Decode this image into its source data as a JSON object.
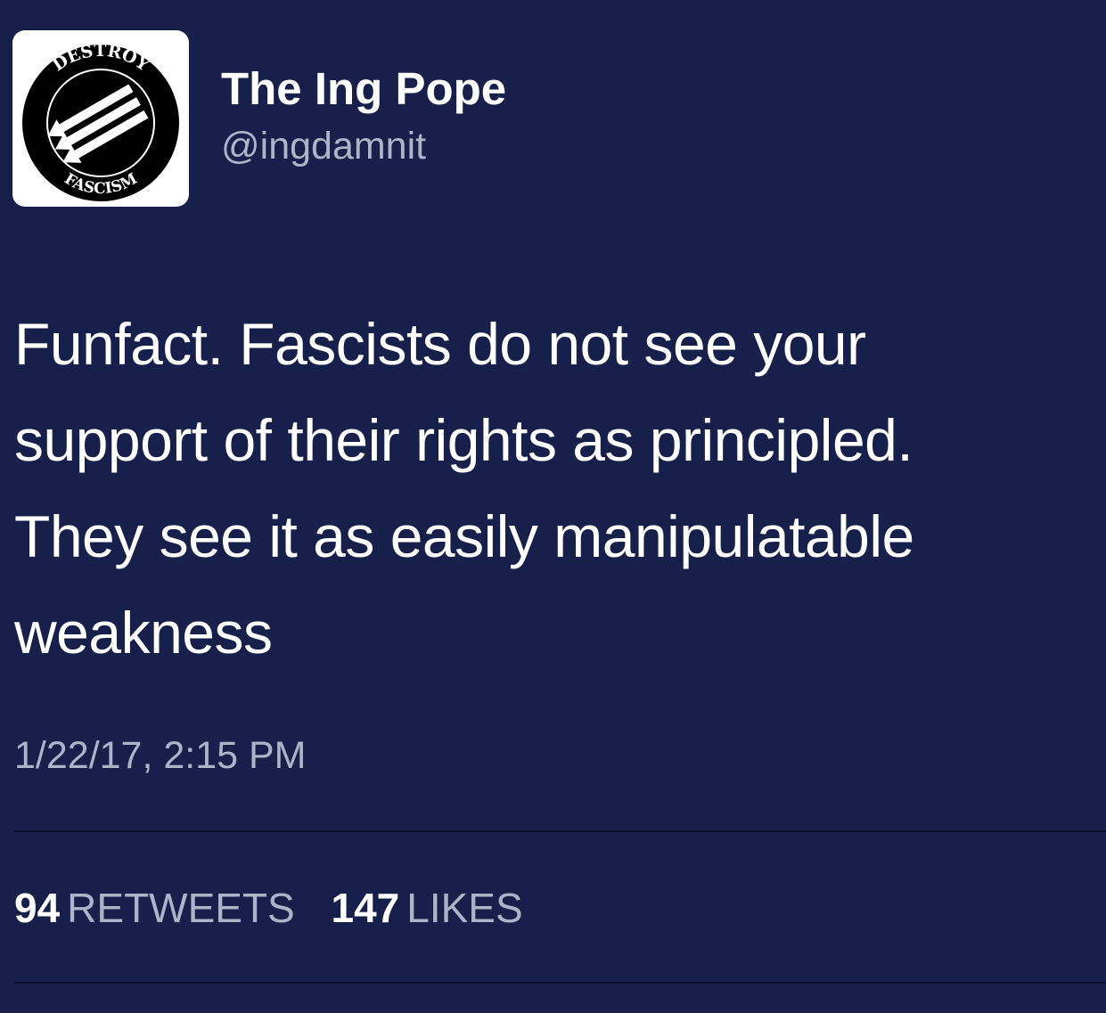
{
  "user": {
    "display_name": "The Ing Pope",
    "handle": "@ingdamnit",
    "avatar": {
      "icon": "destroy-fascism-three-arrows-icon",
      "text_top": "DESTROY",
      "text_bottom": "FASCISM"
    }
  },
  "tweet": {
    "lines": [
      "Funfact. Fascists do not see your",
      "support of their rights as principled.",
      "They see it as easily manipulatable",
      "weakness"
    ],
    "timestamp": "1/22/17, 2:15 PM"
  },
  "stats": {
    "retweets_count": "94",
    "retweets_label": "RETWEETS",
    "likes_count": "147",
    "likes_label": "LIKES"
  },
  "colors": {
    "background": "#17204a",
    "primary_text": "#ffffff",
    "secondary_text": "#aab6c8",
    "divider": "#0b1130"
  }
}
